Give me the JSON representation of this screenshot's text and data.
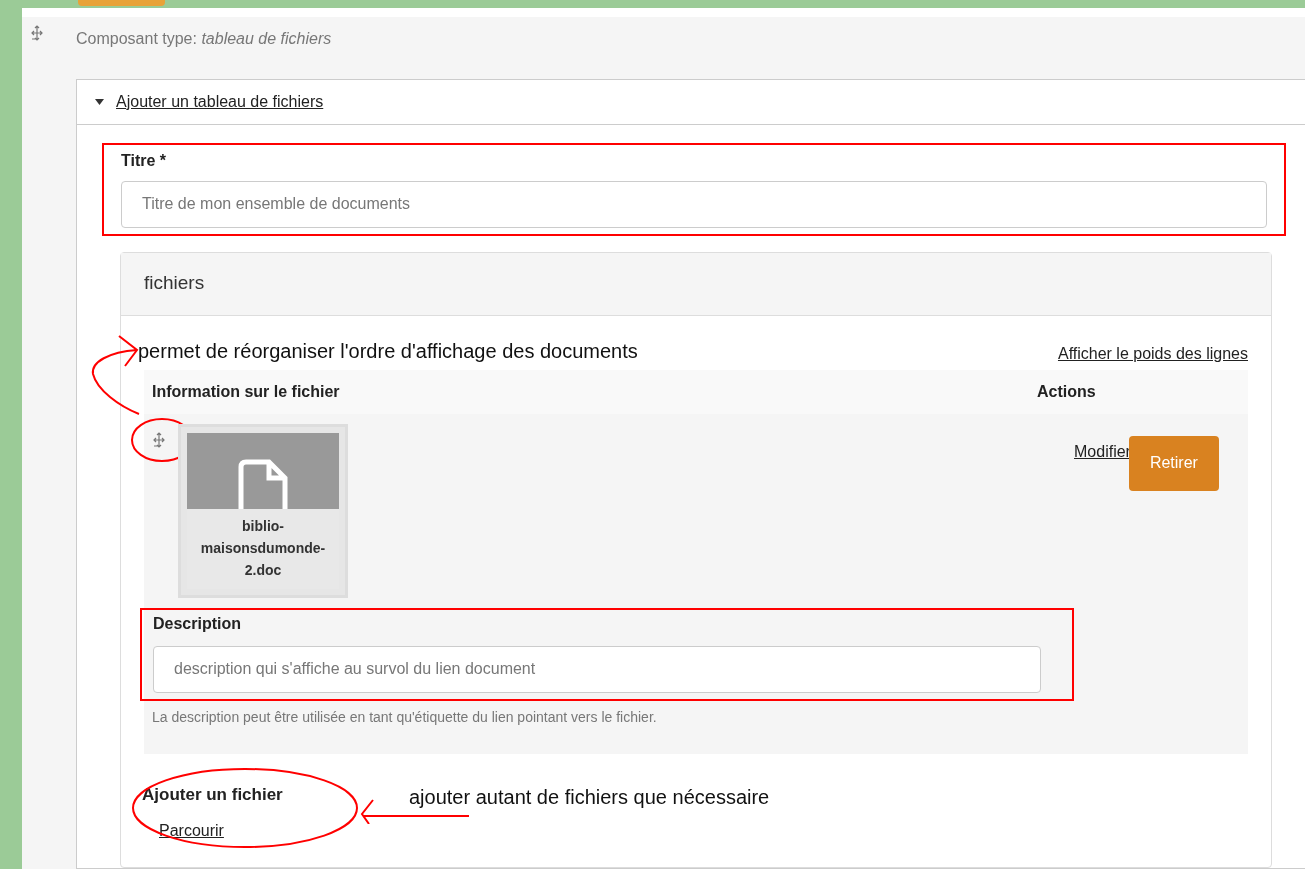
{
  "component_type": {
    "label": "Composant type:",
    "value": "tableau de fichiers"
  },
  "details": {
    "summary": "Ajouter un tableau de fichiers",
    "expanded": true
  },
  "title_field": {
    "label": "Titre *",
    "placeholder": "Titre de mon ensemble de documents"
  },
  "files_panel": {
    "legend": "fichiers",
    "show_weights_link": "Afficher le poids des lignes",
    "table": {
      "columns": [
        "Information sur le fichier",
        "Actions"
      ],
      "rows": [
        {
          "file_name": "biblio-maisonsdumonde-2.doc",
          "description_label": "Description",
          "description_placeholder": "description qui s'affiche au survol du lien document",
          "help": "La description peut être utilisée en tant qu'étiquette du lien pointant vers le fichier.",
          "actions": [
            "Modifier",
            "Retirer"
          ]
        }
      ]
    },
    "add_file": {
      "label": "Ajouter un fichier",
      "button": "Parcourir"
    }
  },
  "annotations": [
    {
      "text": "permet de réorganiser l'ordre d'affichage des documents"
    },
    {
      "text": "ajouter autant de fichiers que nécessaire"
    }
  ]
}
